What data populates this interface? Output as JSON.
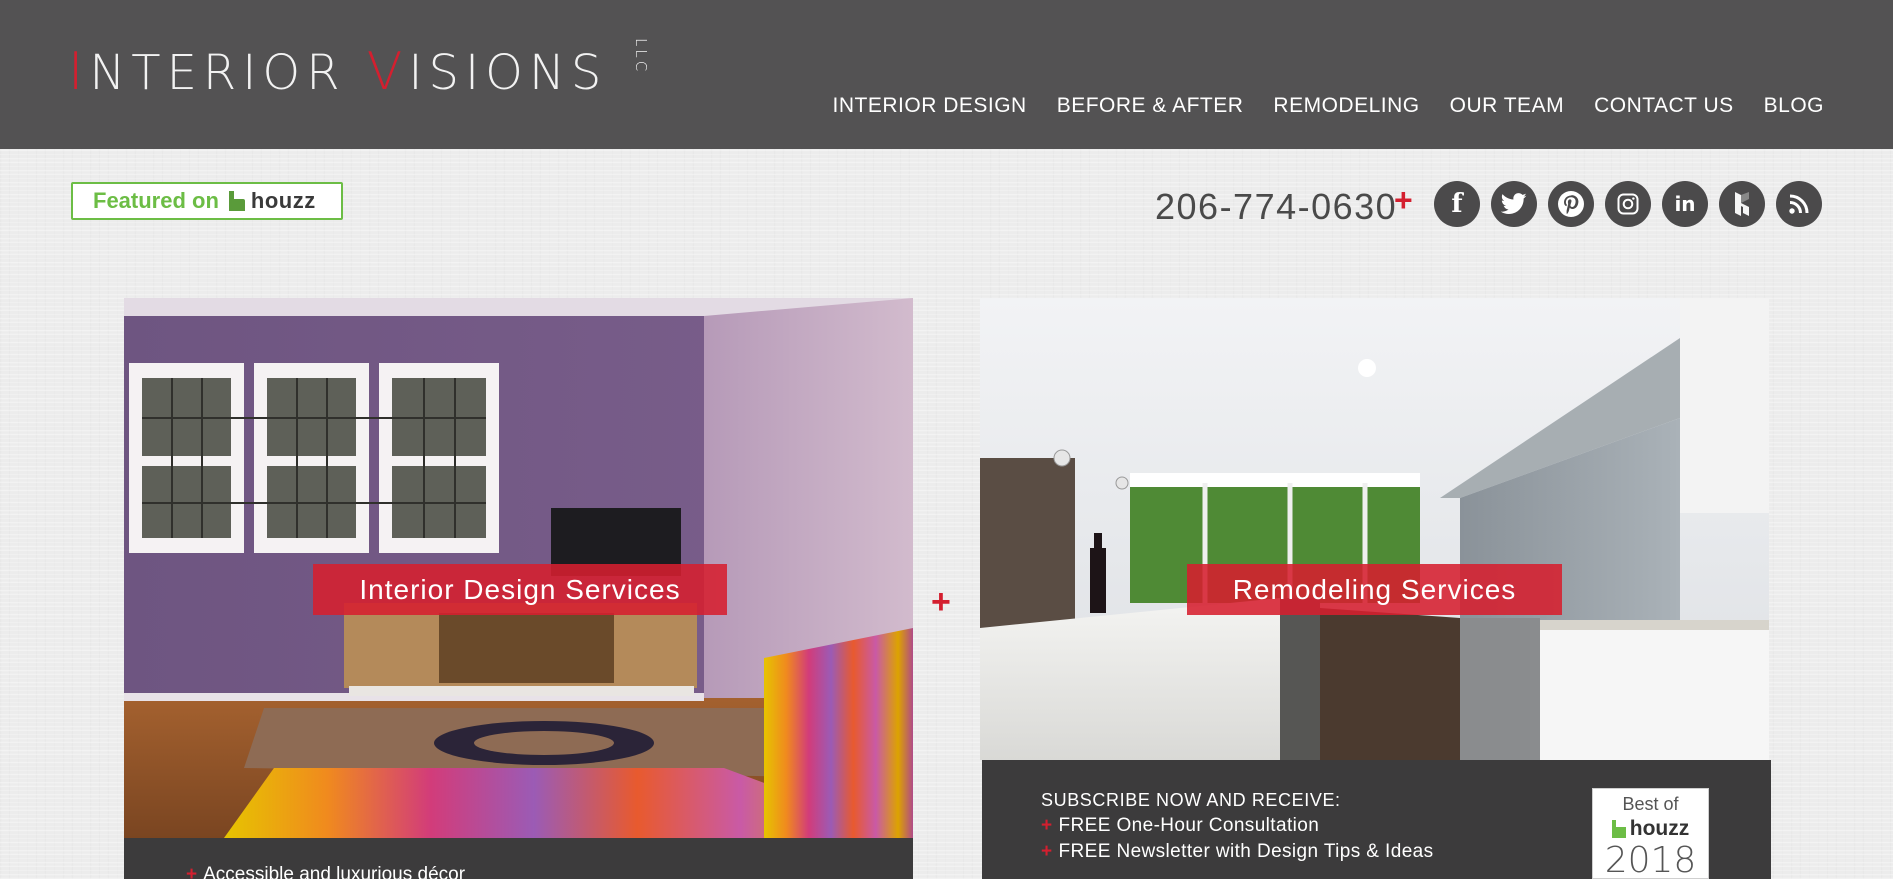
{
  "brand": {
    "logo_initial_1": "I",
    "logo_rest_1": "NTERIOR ",
    "logo_initial_2": "V",
    "logo_rest_2": "ISIONS",
    "logo_suffix": "LLC"
  },
  "nav": {
    "items": [
      {
        "label": "INTERIOR DESIGN"
      },
      {
        "label": "BEFORE & AFTER"
      },
      {
        "label": "REMODELING"
      },
      {
        "label": "OUR TEAM"
      },
      {
        "label": "CONTACT US"
      },
      {
        "label": "BLOG"
      }
    ]
  },
  "houzz_badge": {
    "featured_text": "Featured on",
    "brand_word": "houzz"
  },
  "contact": {
    "phone": "206-774-0630",
    "separator": "+"
  },
  "socials": [
    {
      "icon": "facebook-icon",
      "glyph": "f"
    },
    {
      "icon": "twitter-icon"
    },
    {
      "icon": "pinterest-icon",
      "glyph": "p"
    },
    {
      "icon": "instagram-icon"
    },
    {
      "icon": "linkedin-icon",
      "glyph": "in"
    },
    {
      "icon": "houzz-icon"
    },
    {
      "icon": "rss-icon"
    }
  ],
  "services": {
    "left_label": "Interior Design Services",
    "right_label": "Remodeling Services",
    "separator": "+"
  },
  "left_panel": {
    "bullet_1": "Accessible and luxurious décor"
  },
  "subscribe": {
    "title": "SUBSCRIBE NOW AND RECEIVE:",
    "item_1": "FREE One-Hour Consultation",
    "item_2": "FREE Newsletter with Design Tips & Ideas",
    "bullet_mark": "+"
  },
  "award_badge": {
    "line_1": "Best of",
    "brand_word": "houzz",
    "year": "2018"
  },
  "colors": {
    "header_bg": "#535253",
    "accent_red": "#d41f2f",
    "houzz_green": "#6cbd45",
    "panel_bg": "#3c3b3c"
  }
}
